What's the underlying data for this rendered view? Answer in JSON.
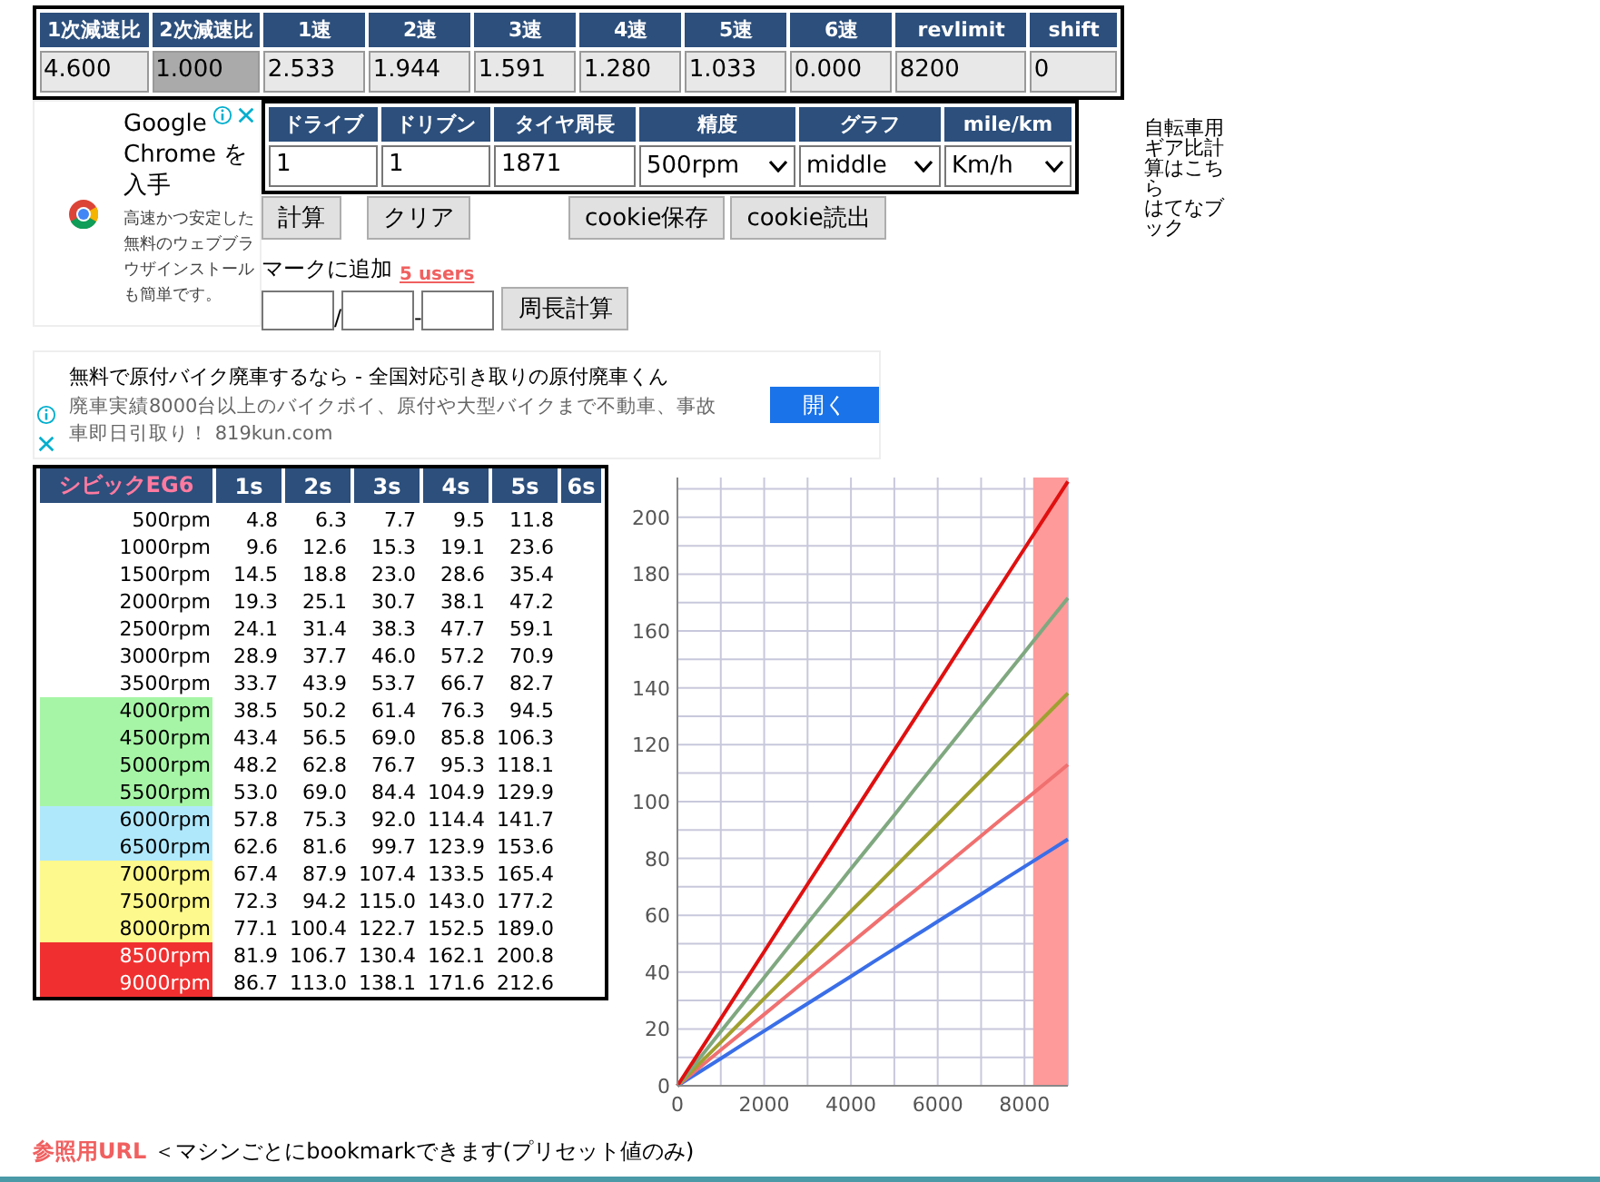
{
  "ratio_table": {
    "columns": [
      "1次減速比",
      "2次減速比",
      "1速",
      "2速",
      "3速",
      "4速",
      "5速",
      "6速",
      "revlimit",
      "shift"
    ],
    "values": [
      {
        "value": "4.600",
        "disabled": false
      },
      {
        "value": "1.000",
        "disabled": true
      },
      {
        "value": "2.533",
        "disabled": false
      },
      {
        "value": "1.944",
        "disabled": false
      },
      {
        "value": "1.591",
        "disabled": false
      },
      {
        "value": "1.280",
        "disabled": false
      },
      {
        "value": "1.033",
        "disabled": false
      },
      {
        "value": "0.000",
        "disabled": false
      },
      {
        "value": "8200",
        "disabled": false
      },
      {
        "value": "0",
        "disabled": false
      }
    ]
  },
  "ad_top": {
    "title": "Google Chrome を入手",
    "body": "高速かつ安定した無料のウェブブラウザインストールも簡単です。"
  },
  "settings_table": {
    "columns": [
      "ドライブ",
      "ドリブン",
      "タイヤ周長",
      "精度",
      "グラフ",
      "mile/km"
    ],
    "fields": [
      {
        "kind": "input",
        "value": "1"
      },
      {
        "kind": "input",
        "value": "1"
      },
      {
        "kind": "input",
        "value": "1871"
      },
      {
        "kind": "select",
        "value": "500rpm"
      },
      {
        "kind": "select",
        "value": "middle"
      },
      {
        "kind": "select",
        "value": "Km/h"
      }
    ]
  },
  "buttons": [
    "計算",
    "クリア",
    "cookie保存",
    "cookie読出"
  ],
  "bookmark": {
    "label": "マークに追加",
    "count": "5 users"
  },
  "circumference": {
    "separators": [
      "/",
      "-"
    ],
    "button": "周長計算"
  },
  "side_link": {
    "text": "自転車用ギア比計算はこちら",
    "bookmark": "はてなブック"
  },
  "ad_mid": {
    "title": "無料で原付バイク廃車するなら - 全国対応引き取りの原付廃車くん",
    "body": "廃車実績8000台以上のバイクボイ、原付や大型バイクまで不動車、事故車即日引取り！ 819kun.com",
    "button": "開く"
  },
  "speed_table": {
    "columns": [
      "シビックEG6",
      "1s",
      "2s",
      "3s",
      "4s",
      "5s",
      "6s"
    ],
    "rows": [
      {
        "rpm": "500rpm",
        "color": "#ffffff",
        "values": [
          "4.8",
          "6.3",
          "7.7",
          "9.5",
          "11.8"
        ]
      },
      {
        "rpm": "1000rpm",
        "color": "#ffffff",
        "values": [
          "9.6",
          "12.6",
          "15.3",
          "19.1",
          "23.6"
        ]
      },
      {
        "rpm": "1500rpm",
        "color": "#ffffff",
        "values": [
          "14.5",
          "18.8",
          "23.0",
          "28.6",
          "35.4"
        ]
      },
      {
        "rpm": "2000rpm",
        "color": "#ffffff",
        "values": [
          "19.3",
          "25.1",
          "30.7",
          "38.1",
          "47.2"
        ]
      },
      {
        "rpm": "2500rpm",
        "color": "#ffffff",
        "values": [
          "24.1",
          "31.4",
          "38.3",
          "47.7",
          "59.1"
        ]
      },
      {
        "rpm": "3000rpm",
        "color": "#ffffff",
        "values": [
          "28.9",
          "37.7",
          "46.0",
          "57.2",
          "70.9"
        ]
      },
      {
        "rpm": "3500rpm",
        "color": "#ffffff",
        "values": [
          "33.7",
          "43.9",
          "53.7",
          "66.7",
          "82.7"
        ]
      },
      {
        "rpm": "4000rpm",
        "color": "#a6f5a6",
        "values": [
          "38.5",
          "50.2",
          "61.4",
          "76.3",
          "94.5"
        ]
      },
      {
        "rpm": "4500rpm",
        "color": "#a6f5a6",
        "values": [
          "43.4",
          "56.5",
          "69.0",
          "85.8",
          "106.3"
        ]
      },
      {
        "rpm": "5000rpm",
        "color": "#a6f5a6",
        "values": [
          "48.2",
          "62.8",
          "76.7",
          "95.3",
          "118.1"
        ]
      },
      {
        "rpm": "5500rpm",
        "color": "#a6f5a6",
        "values": [
          "53.0",
          "69.0",
          "84.4",
          "104.9",
          "129.9"
        ]
      },
      {
        "rpm": "6000rpm",
        "color": "#b0e8fb",
        "values": [
          "57.8",
          "75.3",
          "92.0",
          "114.4",
          "141.7"
        ]
      },
      {
        "rpm": "6500rpm",
        "color": "#b0e8fb",
        "values": [
          "62.6",
          "81.6",
          "99.7",
          "123.9",
          "153.6"
        ]
      },
      {
        "rpm": "7000rpm",
        "color": "#fdf98c",
        "values": [
          "67.4",
          "87.9",
          "107.4",
          "133.5",
          "165.4"
        ]
      },
      {
        "rpm": "7500rpm",
        "color": "#fdf98c",
        "values": [
          "72.3",
          "94.2",
          "115.0",
          "143.0",
          "177.2"
        ]
      },
      {
        "rpm": "8000rpm",
        "color": "#fdf98c",
        "values": [
          "77.1",
          "100.4",
          "122.7",
          "152.5",
          "189.0"
        ]
      },
      {
        "rpm": "8500rpm",
        "color": "#f03030",
        "values": [
          "81.9",
          "106.7",
          "130.4",
          "162.1",
          "200.8"
        ]
      },
      {
        "rpm": "9000rpm",
        "color": "#f03030",
        "values": [
          "86.7",
          "113.0",
          "138.1",
          "171.6",
          "212.6"
        ]
      }
    ]
  },
  "chart": {
    "chart_data": {
      "type": "line",
      "x": [
        0,
        500,
        1000,
        1500,
        2000,
        2500,
        3000,
        3500,
        4000,
        4500,
        5000,
        5500,
        6000,
        6500,
        7000,
        7500,
        8000,
        8500,
        9000
      ],
      "series": [
        {
          "color": "#3a6ee8",
          "values": [
            0,
            4.8,
            9.6,
            14.5,
            19.3,
            24.1,
            28.9,
            33.7,
            38.5,
            43.4,
            48.2,
            53.0,
            57.8,
            62.6,
            67.4,
            72.3,
            77.1,
            81.9,
            86.7
          ]
        },
        {
          "color": "#f07070",
          "values": [
            0,
            6.3,
            12.6,
            18.8,
            25.1,
            31.4,
            37.7,
            43.9,
            50.2,
            56.5,
            62.8,
            69.0,
            75.3,
            81.6,
            87.9,
            94.2,
            100.4,
            106.7,
            113.0
          ]
        },
        {
          "color": "#a0a030",
          "values": [
            0,
            7.7,
            15.3,
            23.0,
            30.7,
            38.3,
            46.0,
            53.7,
            61.4,
            69.0,
            76.7,
            84.4,
            92.0,
            99.7,
            107.4,
            115.0,
            122.7,
            130.4,
            138.1
          ]
        },
        {
          "color": "#80a880",
          "values": [
            0,
            9.5,
            19.1,
            28.6,
            38.1,
            47.7,
            57.2,
            66.7,
            76.3,
            85.8,
            95.3,
            104.9,
            114.4,
            123.9,
            133.5,
            143.0,
            152.5,
            162.1,
            171.6
          ]
        },
        {
          "color": "#e01010",
          "values": [
            0,
            11.8,
            23.6,
            35.4,
            47.2,
            59.1,
            70.9,
            82.7,
            94.5,
            106.3,
            118.1,
            129.9,
            141.7,
            153.6,
            165.4,
            177.2,
            189.0,
            200.8,
            212.6
          ]
        }
      ],
      "xlim": [
        0,
        9000
      ],
      "ylim": [
        0,
        214
      ],
      "xticks": [
        0,
        2000,
        4000,
        6000,
        8000
      ],
      "yticks": [
        0,
        20,
        40,
        60,
        80,
        100,
        120,
        140,
        160,
        180,
        200
      ],
      "grid": true,
      "bands": [
        {
          "axis": "x",
          "from": 8200,
          "to": 9000,
          "color": "#ff9a9a"
        }
      ]
    }
  },
  "reference": {
    "link": "参照用URL",
    "text": "＜マシンごとにbookmarkできます(プリセット値のみ)"
  }
}
